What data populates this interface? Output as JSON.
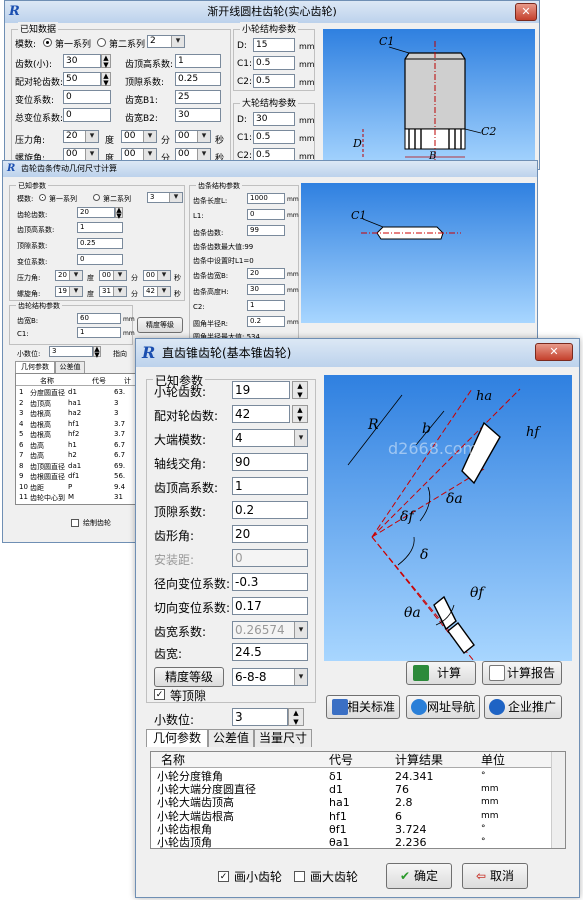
{
  "w1": {
    "title": "渐开线圆柱齿轮(实心齿轮)",
    "close": "✕",
    "known": "已知数据",
    "module_lbl": "模数:",
    "series1": "第一系列",
    "series2": "第二系列",
    "module_val": "2",
    "z_small_lbl": "齿数(小):",
    "z_small": "30",
    "ha_lbl": "齿顶高系数:",
    "ha": "1",
    "z_mate_lbl": "配对轮齿数:",
    "z_mate": "50",
    "c_lbl": "顶隙系数:",
    "c": "0.25",
    "x_lbl": "变位系数:",
    "x": "0",
    "b1_lbl": "齿宽B1:",
    "b1": "25",
    "xt_lbl": "总变位系数:",
    "xt": "0",
    "b2_lbl": "齿宽B2:",
    "b2": "30",
    "alpha_lbl": "压力角:",
    "alpha_d": "20",
    "alpha_m": "00",
    "alpha_s": "00",
    "beta_lbl": "螺旋角:",
    "beta_d": "00",
    "beta_m": "00",
    "beta_s": "00",
    "deg": "度",
    "min": "分",
    "sec": "秒",
    "small_title": "小轮结构参数",
    "big_title": "大轮结构参数",
    "D": "D:",
    "C1": "C1:",
    "C2": "C2:",
    "s_D": "15",
    "s_C1": "0.5",
    "s_C2": "0.5",
    "b_D": "30",
    "b_C1": "0.5",
    "b_C2": "0.5",
    "mm": "mm",
    "pic_C1": "C1",
    "pic_C2": "C2",
    "pic_D": "D",
    "pic_B": "B"
  },
  "w2": {
    "title": "齿轮齿条传动几何尺寸计算",
    "known": "已知参数",
    "module_lbl": "模数:",
    "series1": "第一系列",
    "series2": "第二系列",
    "module_val": "3",
    "z_lbl": "齿轮齿数:",
    "z": "20",
    "ha_lbl": "齿顶高系数:",
    "ha": "1",
    "c_lbl": "顶隙系数:",
    "c": "0.25",
    "x_lbl": "变位系数:",
    "x": "0",
    "alpha_lbl": "压力角:",
    "alpha_d": "20",
    "alpha_m": "00",
    "alpha_s": "00",
    "beta_lbl": "螺旋角:",
    "beta_d": "19",
    "beta_m": "31",
    "beta_s": "42",
    "deg": "度",
    "min": "分",
    "sec": "秒",
    "rack_title": "齿条结构参数",
    "rackL_lbl": "齿条长度L:",
    "rackL": "1000",
    "L1_lbl": "L1:",
    "L1": "0",
    "rz_lbl": "齿条齿数:",
    "rz": "99",
    "rzmax": "齿条齿数最大值:99",
    "rmid": "齿条中设置时L1=0",
    "rB_lbl": "齿条齿宽B:",
    "rB": "20",
    "rH_lbl": "齿条高度H:",
    "rH": "30",
    "rC2_lbl": "C2:",
    "rC2": "1",
    "rr_lbl": "圆角半径R:",
    "rr": "0.2",
    "rrmax": "圆角半径最大值:.534",
    "gear_title": "齿轮结构参数",
    "gB_lbl": "齿宽B:",
    "gB": "60",
    "gC1_lbl": "C1:",
    "gC1": "1",
    "mm": "mm",
    "prec_btn": "精度等级",
    "dec_lbl": "小数位:",
    "dec": "3",
    "pos_lbl": "指向",
    "tab1": "几何参数",
    "tab2": "公差值",
    "cols": [
      "名称",
      "代号",
      "计"
    ],
    "rows": [
      [
        "1",
        "分度圆直径",
        "d1",
        "63."
      ],
      [
        "2",
        "齿顶高",
        "ha1",
        "3"
      ],
      [
        "3",
        "齿根高",
        "ha2",
        "3"
      ],
      [
        "4",
        "齿根高",
        "hf1",
        "3.7"
      ],
      [
        "5",
        "齿根高",
        "hf2",
        "3.7"
      ],
      [
        "6",
        "齿高",
        "h1",
        "6.7"
      ],
      [
        "7",
        "齿高",
        "h2",
        "6.7"
      ],
      [
        "8",
        "齿顶圆直径",
        "da1",
        "69."
      ],
      [
        "9",
        "齿根圆直径",
        "df1",
        "56."
      ],
      [
        "10",
        "齿距",
        "P",
        "9.4"
      ],
      [
        "11",
        "齿轮中心到",
        "M",
        "31"
      ]
    ],
    "chk": "绘制齿轮",
    "pic_C1": "C1"
  },
  "w3": {
    "title": "直齿锥齿轮(基本锥齿轮)",
    "known": "已知参数",
    "z1_lbl": "小轮齿数:",
    "z1": "19",
    "z2_lbl": "配对轮齿数:",
    "z2": "42",
    "m_lbl": "大端模数:",
    "m": "4",
    "sigma_lbl": "轴线交角:",
    "sigma": "90",
    "ha_lbl": "齿顶高系数:",
    "ha": "1",
    "c_lbl": "顶隙系数:",
    "c": "0.2",
    "alpha_lbl": "齿形角:",
    "alpha": "20",
    "ins_lbl": "安装距:",
    "ins": "0",
    "xr_lbl": "径向变位系数:",
    "xr": "-0.3",
    "xt_lbl": "切向变位系数:",
    "xt": "0.17",
    "bf_lbl": "齿宽系数:",
    "bf": "0.26574",
    "b_lbl": "齿宽:",
    "b": "24.5",
    "prec_btn": "精度等级",
    "prec": "6-8-8",
    "eqc": "等顶隙",
    "dec_lbl": "小数位:",
    "dec": "3",
    "calc": "计算",
    "report": "计算报告",
    "std": "相关标准",
    "nav": "网址导航",
    "ent": "企业推广",
    "tab1": "几何参数",
    "tab2": "公差值",
    "tab3": "当量尺寸",
    "cols": [
      "名称",
      "代号",
      "计算结果",
      "单位"
    ],
    "rows": [
      [
        "小轮分度锥角",
        "δ1",
        "24.341",
        "°"
      ],
      [
        "小轮大端分度圆直径",
        "d1",
        "76",
        "mm"
      ],
      [
        "小轮大端齿顶高",
        "ha1",
        "2.8",
        "mm"
      ],
      [
        "小轮大端齿根高",
        "hf1",
        "6",
        "mm"
      ],
      [
        "小轮齿根角",
        "θf1",
        "3.724",
        "°"
      ],
      [
        "小轮齿顶角",
        "θa1",
        "2.236",
        "°"
      ]
    ],
    "draw_small": "画小齿轮",
    "draw_big": "画大齿轮",
    "ok": "确定",
    "cancel": "取消",
    "watermark": "d2668.com",
    "pic": {
      "ha": "ha",
      "hf": "hf",
      "R": "R",
      "b": "b",
      "da": "δa",
      "df": "δf",
      "d": "δ",
      "tf": "θf",
      "ta": "θa"
    }
  }
}
